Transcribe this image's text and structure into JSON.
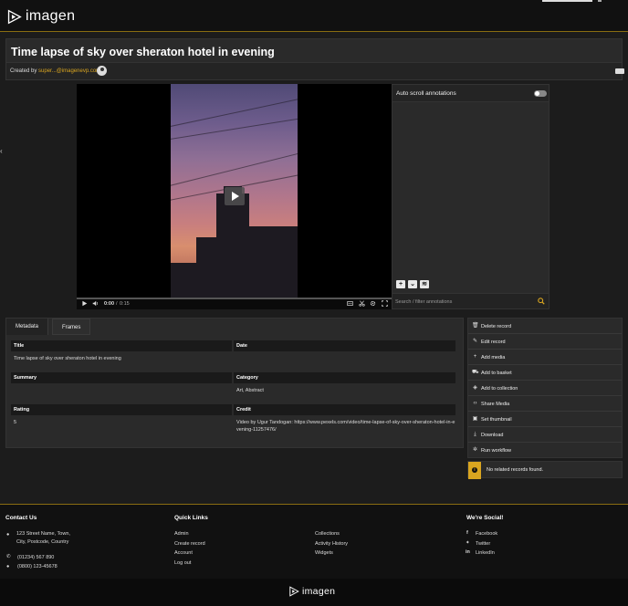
{
  "header": {
    "logo_text": "imagen"
  },
  "record": {
    "title": "Time lapse of sky over sheraton hotel in evening",
    "created_by_label": "Created by",
    "created_by_user": "super...@imagenevp.com"
  },
  "player": {
    "time_current": "0:00",
    "time_separator": "/",
    "time_total": "0:15"
  },
  "annotations": {
    "auto_scroll_label": "Auto scroll annotations",
    "search_placeholder": "Search / filter annotations"
  },
  "tabs": [
    {
      "label": "Metadata"
    },
    {
      "label": "Frames"
    }
  ],
  "metadata": {
    "title_label": "Title",
    "title_value": "Time lapse of sky over sheraton hotel in evening",
    "date_label": "Date",
    "date_value": "",
    "summary_label": "Summary",
    "summary_value": "",
    "category_label": "Category",
    "category_value": "Art, Abstract",
    "rating_label": "Rating",
    "rating_value": "5",
    "credit_label": "Credit",
    "credit_value": "Video by Ugur Tandogan: https://www.pexels.com/video/time-lapse-of-sky-over-sheraton-hotel-in-evening-11257476/"
  },
  "actions": [
    {
      "label": "Delete record",
      "icon": "trash-icon"
    },
    {
      "label": "Edit record",
      "icon": "pencil-icon"
    },
    {
      "label": "Add media",
      "icon": "plus-icon"
    },
    {
      "label": "Add to basket",
      "icon": "cart-icon"
    },
    {
      "label": "Add to collection",
      "icon": "collection-icon"
    },
    {
      "label": "Share Media",
      "icon": "code-icon"
    },
    {
      "label": "Set thumbnail",
      "icon": "image-icon"
    },
    {
      "label": "Download",
      "icon": "download-icon"
    },
    {
      "label": "Run workflow",
      "icon": "workflow-icon"
    }
  ],
  "related": {
    "message": "No related records found."
  },
  "footer": {
    "contact_title": "Contact Us",
    "address_line1": "123 Street Name, Town,",
    "address_line2": "City, Postcode, Country",
    "phone": "(01234) 567 890",
    "phone2": "(0800) 123-45678",
    "quick_links_title": "Quick Links",
    "links_col1": [
      "Admin",
      "Create record",
      "Account",
      "Log out"
    ],
    "links_col2": [
      "Collections",
      "Activity History",
      "Widgets"
    ],
    "social_title": "We're Social!",
    "social": [
      "Facebook",
      "Twitter",
      "LinkedIn"
    ],
    "bottom_logo_text": "imagen"
  },
  "colors": {
    "accent": "#d9a520",
    "background": "#1c1c1c",
    "panel": "#2a2a2a"
  }
}
